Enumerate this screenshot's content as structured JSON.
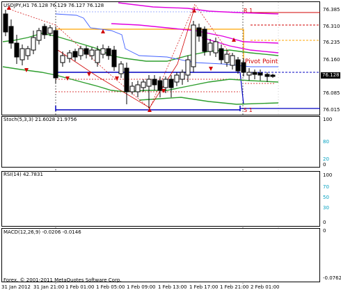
{
  "main_chart": {
    "header": "USDJPY,H1  76.128 76.129 76.127 76.128",
    "current_price": "76.128",
    "price_axis": [
      "76.385",
      "76.310",
      "76.235",
      "76.160",
      "76.085",
      "76.015"
    ],
    "annotations": {
      "r1": "R 1",
      "pivot": "Pivot Point",
      "s1": "S 1"
    }
  },
  "stoch": {
    "header": "Stoch(5,3,3) 21.6028 21.9756",
    "axis": [
      "100",
      "80",
      "20",
      "0"
    ]
  },
  "rsi": {
    "header": "RSI(14) 42.7831",
    "axis": [
      "100",
      "70",
      "50",
      "30",
      "0"
    ]
  },
  "macd": {
    "header": "MACD(12,26,9) -0.0206 -0.0146",
    "axis": [
      "0",
      "-0.0762"
    ],
    "copyright": "Forex. © 2001-2011 MetaQuotes Software Corp."
  },
  "time_axis": [
    "31 Jan 2012",
    "31 Jan 21:00",
    "1 Feb 01:00",
    "1 Feb 05:00",
    "1 Feb 09:00",
    "1 Feb 13:00",
    "1 Feb 17:00",
    "1 Feb 21:00",
    "2 Feb 01:00"
  ],
  "colors": {
    "bull": "#ffffff",
    "bear": "#000000",
    "green": "#2e9e2e",
    "magenta": "#e000e0",
    "orange": "#ffa500",
    "blue": "#0000c0",
    "red": "#d00000",
    "cyan": "#40d0d0"
  }
}
